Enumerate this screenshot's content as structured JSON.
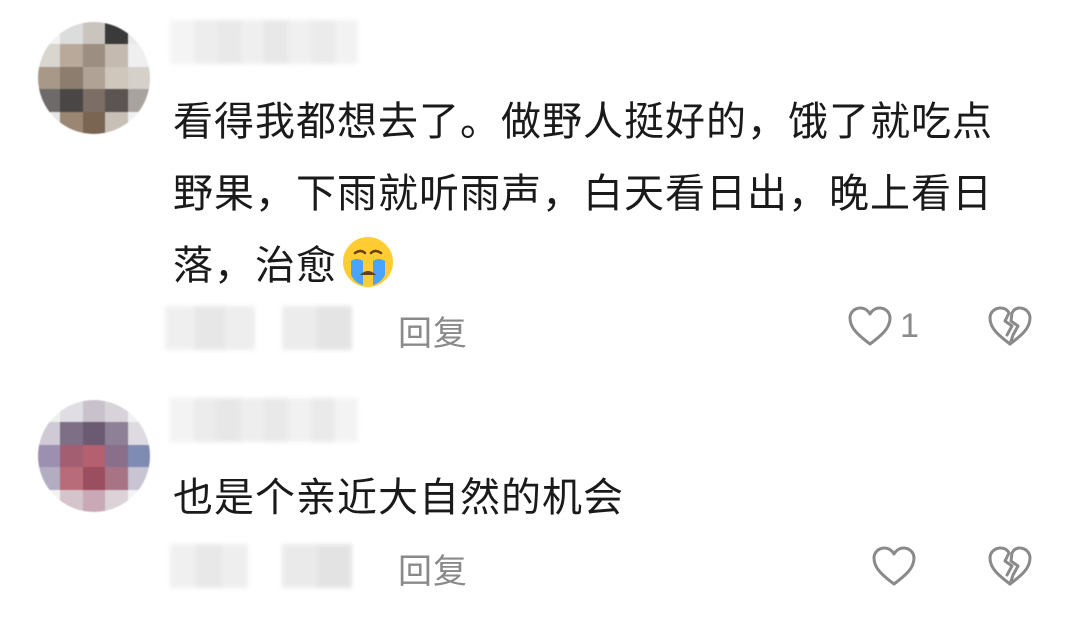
{
  "comments": [
    {
      "text_lines": [
        "看得我都想去了。做野人挺好的，饿了就吃点",
        "野果，下雨就听雨声，白天看日出，晚上看日",
        "落，治愈"
      ],
      "emoji": "loudly-crying-face",
      "reply_label": "回复",
      "like_count": "1"
    },
    {
      "text_lines": [
        "也是个亲近大自然的机会"
      ],
      "reply_label": "回复",
      "like_count": ""
    }
  ],
  "icons": {
    "like": "heart-outline-icon",
    "dislike": "broken-heart-outline-icon"
  },
  "colors": {
    "text": "#1a1a1a",
    "secondary": "#8a8a8a",
    "icon": "#8a8a8a"
  }
}
